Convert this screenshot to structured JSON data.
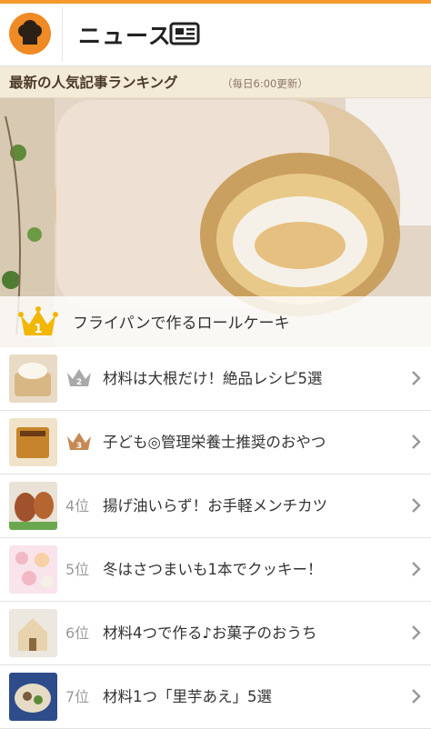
{
  "header": {
    "title": "ニュース"
  },
  "subheader": {
    "title": "最新の人気記事ランキング",
    "note": "（毎日6:00更新）"
  },
  "featured": {
    "rank": "1",
    "title": "フライパンで作るロールケーキ"
  },
  "articles": [
    {
      "rank": "2",
      "rank_label": "",
      "title": "材料は大根だけ！絶品レシピ5選",
      "crown": "silver"
    },
    {
      "rank": "3",
      "rank_label": "",
      "title": "子ども◎管理栄養士推奨のおやつ",
      "crown": "bronze"
    },
    {
      "rank": "4",
      "rank_label": "4位",
      "title": "揚げ油いらず！お手軽メンチカツ",
      "crown": ""
    },
    {
      "rank": "5",
      "rank_label": "5位",
      "title": "冬はさつまいも1本でクッキー！",
      "crown": ""
    },
    {
      "rank": "6",
      "rank_label": "6位",
      "title": "材料4つで作る♪お菓子のおうち",
      "crown": ""
    },
    {
      "rank": "7",
      "rank_label": "7位",
      "title": "材料1つ「里芋あえ」5選",
      "crown": ""
    }
  ],
  "colors": {
    "accent": "#f08a24",
    "gold": "#f2b705",
    "silver": "#a9a9a9",
    "bronze": "#c58a54"
  }
}
